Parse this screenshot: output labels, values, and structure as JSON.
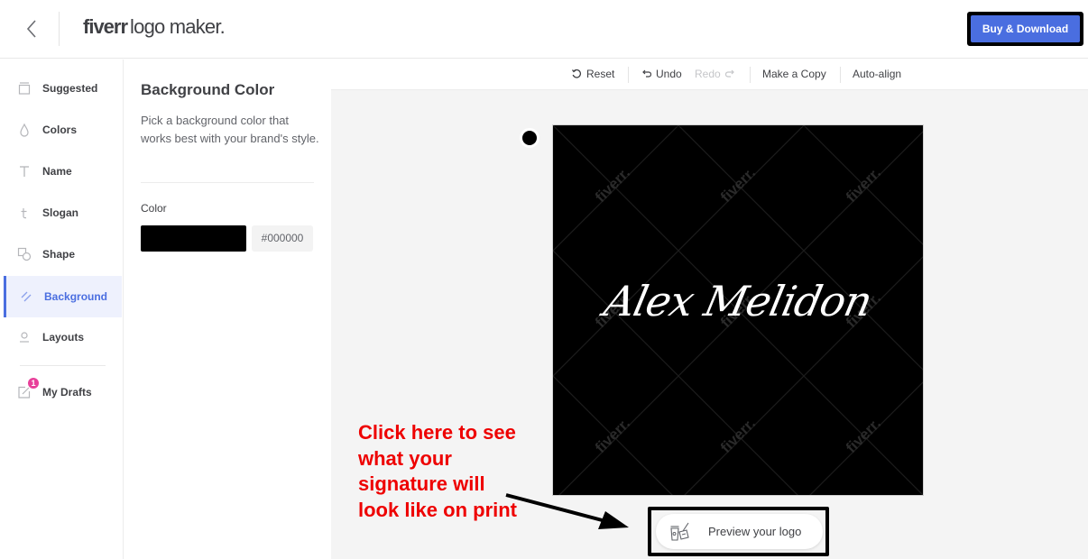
{
  "header": {
    "back_icon": "chevron-left-icon",
    "brand_bold": "fiverr",
    "brand_rest": "logo maker.",
    "buy_label": "Buy & Download",
    "accent_color": "#4a6ee0"
  },
  "sidebar": {
    "items": [
      {
        "label": "Suggested",
        "icon": "suggested-icon"
      },
      {
        "label": "Colors",
        "icon": "droplet-icon"
      },
      {
        "label": "Name",
        "icon": "text-t-icon"
      },
      {
        "label": "Slogan",
        "icon": "small-t-icon"
      },
      {
        "label": "Shape",
        "icon": "shapes-icon"
      },
      {
        "label": "Background",
        "icon": "background-stripes-icon",
        "active": true
      },
      {
        "label": "Layouts",
        "icon": "layout-icon"
      },
      {
        "label": "My Drafts",
        "icon": "drafts-edit-icon",
        "badge": "1"
      }
    ]
  },
  "panel": {
    "title": "Background Color",
    "description": "Pick a background color that works best with your brand's style.",
    "color_label": "Color",
    "color_value": "#000000"
  },
  "toolbar": {
    "reset": "Reset",
    "undo": "Undo",
    "redo": "Redo",
    "make_copy": "Make a Copy",
    "auto_align": "Auto-align"
  },
  "canvas": {
    "logo_text": "Alex Melidon",
    "watermark": "fiverr.",
    "background_color": "#000000"
  },
  "preview": {
    "label": "Preview your logo"
  },
  "annotation": {
    "text": "Click here to see what your signature will look like on print",
    "color": "#ee0000"
  }
}
